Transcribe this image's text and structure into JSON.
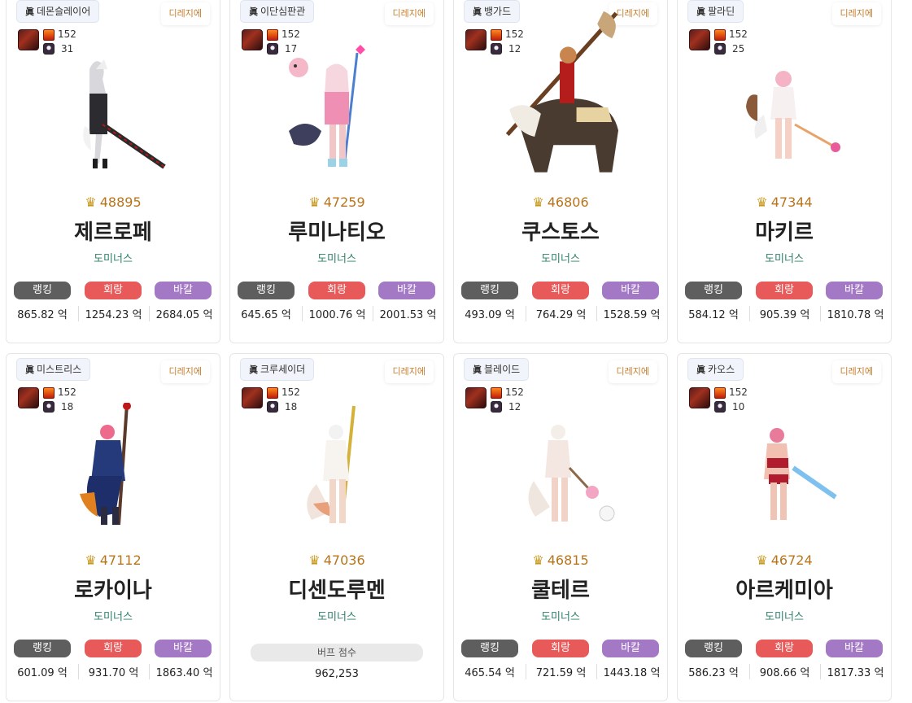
{
  "cards": [
    {
      "class": "데몬슬레이어",
      "adventure_tag": "디레지에",
      "emblem_a": "152",
      "emblem_b": "31",
      "score": "48895",
      "name": "제르로페",
      "guild": "도미너스",
      "labels": {
        "rank": "랭킹",
        "hoe": "회랑",
        "bak": "바칼"
      },
      "values": {
        "rank": "865.82 억",
        "hoe": "1254.23 억",
        "bak": "2684.05 억"
      }
    },
    {
      "class": "이단심판관",
      "adventure_tag": "디레지에",
      "emblem_a": "152",
      "emblem_b": "17",
      "score": "47259",
      "name": "루미나티오",
      "guild": "도미너스",
      "labels": {
        "rank": "랭킹",
        "hoe": "회랑",
        "bak": "바칼"
      },
      "values": {
        "rank": "645.65 억",
        "hoe": "1000.76 억",
        "bak": "2001.53 억"
      }
    },
    {
      "class": "뱅가드",
      "adventure_tag": "디레지에",
      "emblem_a": "152",
      "emblem_b": "12",
      "score": "46806",
      "name": "쿠스토스",
      "guild": "도미너스",
      "labels": {
        "rank": "랭킹",
        "hoe": "회랑",
        "bak": "바칼"
      },
      "values": {
        "rank": "493.09 억",
        "hoe": "764.29 억",
        "bak": "1528.59 억"
      }
    },
    {
      "class": "팔라딘",
      "adventure_tag": "디레지에",
      "emblem_a": "152",
      "emblem_b": "25",
      "score": "47344",
      "name": "마키르",
      "guild": "도미너스",
      "labels": {
        "rank": "랭킹",
        "hoe": "회랑",
        "bak": "바칼"
      },
      "values": {
        "rank": "584.12 억",
        "hoe": "905.39 억",
        "bak": "1810.78 억"
      }
    },
    {
      "class": "미스트리스",
      "adventure_tag": "디레지에",
      "emblem_a": "152",
      "emblem_b": "18",
      "score": "47112",
      "name": "로카이나",
      "guild": "도미너스",
      "labels": {
        "rank": "랭킹",
        "hoe": "회랑",
        "bak": "바칼"
      },
      "values": {
        "rank": "601.09 억",
        "hoe": "931.70 억",
        "bak": "1863.40 억"
      }
    },
    {
      "class": "크루세이더",
      "adventure_tag": "디레지에",
      "emblem_a": "152",
      "emblem_b": "18",
      "score": "47036",
      "name": "디센도루멘",
      "guild": "도미너스",
      "buff_label": "버프 점수",
      "buff_value": "962,253"
    },
    {
      "class": "블레이드",
      "adventure_tag": "디레지에",
      "emblem_a": "152",
      "emblem_b": "12",
      "score": "46815",
      "name": "쿨테르",
      "guild": "도미너스",
      "labels": {
        "rank": "랭킹",
        "hoe": "회랑",
        "bak": "바칼"
      },
      "values": {
        "rank": "465.54 억",
        "hoe": "721.59 억",
        "bak": "1443.18 억"
      }
    },
    {
      "class": "카오스",
      "adventure_tag": "디레지에",
      "emblem_a": "152",
      "emblem_b": "10",
      "score": "46724",
      "name": "아르케미아",
      "guild": "도미너스",
      "labels": {
        "rank": "랭킹",
        "hoe": "회랑",
        "bak": "바칼"
      },
      "values": {
        "rank": "586.23 억",
        "hoe": "908.66 억",
        "bak": "1817.33 억"
      }
    }
  ],
  "badge_prefix": "眞",
  "icons": {
    "crown": "crown-icon",
    "emblem": "emblem-icon"
  },
  "colors": {
    "score": "#b8741a",
    "guild": "#2b8069",
    "rank_pill": "#5e5e5e",
    "hoe_pill": "#e85a5a",
    "bak_pill": "#a378c4",
    "tag": "#c77d2d"
  }
}
